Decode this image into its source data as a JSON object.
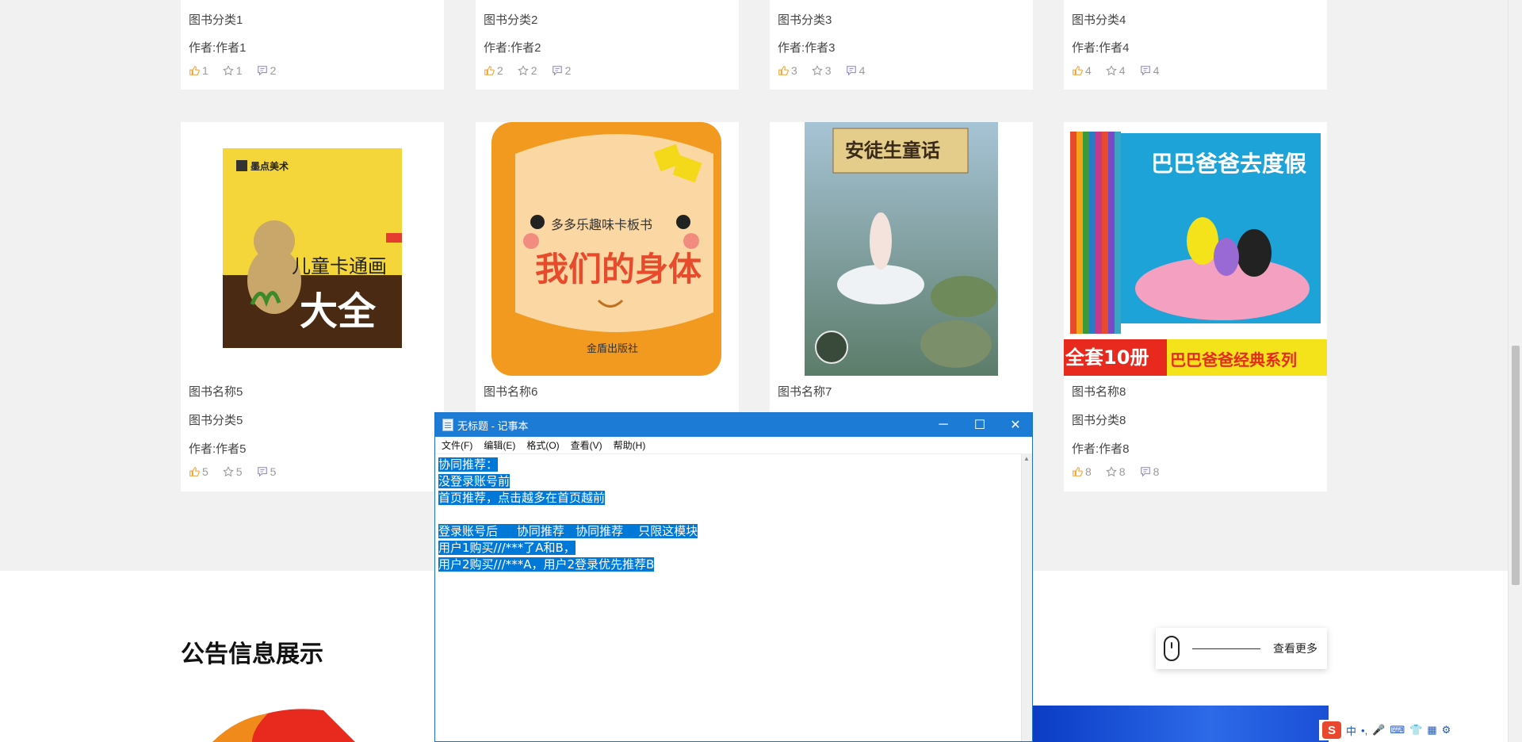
{
  "books": [
    {
      "name": "",
      "category": "图书分类1",
      "author": "作者:作者1",
      "likes": "1",
      "favorites": "1",
      "comments": "2"
    },
    {
      "name": "",
      "category": "图书分类2",
      "author": "作者:作者2",
      "likes": "2",
      "favorites": "2",
      "comments": "2"
    },
    {
      "name": "",
      "category": "图书分类3",
      "author": "作者:作者3",
      "likes": "3",
      "favorites": "3",
      "comments": "4"
    },
    {
      "name": "",
      "category": "图书分类4",
      "author": "作者:作者4",
      "likes": "4",
      "favorites": "4",
      "comments": "4"
    },
    {
      "name": "图书名称5",
      "category": "图书分类5",
      "author": "作者:作者5",
      "likes": "5",
      "favorites": "5",
      "comments": "5",
      "cover": {
        "brand": "墨点美术",
        "title_top": "儿童卡通画",
        "title_big": "大全"
      }
    },
    {
      "name": "图书名称6",
      "category": "",
      "author": "",
      "likes": "",
      "favorites": "",
      "comments": "",
      "cover": {
        "series": "多多乐趣味卡板书",
        "title": "我们的身体",
        "publisher": "金盾出版社"
      }
    },
    {
      "name": "图书名称7",
      "category": "",
      "author": "",
      "likes": "",
      "favorites": "",
      "comments": "",
      "cover": {
        "title": "安徒生童话"
      }
    },
    {
      "name": "图书名称8",
      "category": "图书分类8",
      "author": "作者:作者8",
      "likes": "8",
      "favorites": "8",
      "comments": "8",
      "cover": {
        "title": "巴巴爸爸去度假",
        "banner_a": "全套10册",
        "banner_b": "巴巴爸爸经典系列"
      }
    }
  ],
  "announcement": {
    "title": "公告信息展示",
    "more": "查看更多"
  },
  "notepad": {
    "title": "无标题 - 记事本",
    "menu": [
      "文件(F)",
      "编辑(E)",
      "格式(O)",
      "查看(V)",
      "帮助(H)"
    ],
    "lines": [
      "协同推荐：",
      "没登录账号前",
      "首页推荐，点击越多在首页越前",
      "",
      "登录账号后     协同推荐   协同推荐    只限这模块",
      "用户1购买///***了A和B，",
      "用户2购买///***A，用户2登录优先推荐B"
    ],
    "controls": {
      "minimize": "─",
      "maximize": "☐",
      "close": "✕"
    }
  },
  "tray": {
    "ime": "中"
  },
  "colors": {
    "accent": "#1c7bd4",
    "selection": "#0078d7",
    "like": "#f0a030",
    "fav": "#999999",
    "comment": "#8a7fd6"
  }
}
